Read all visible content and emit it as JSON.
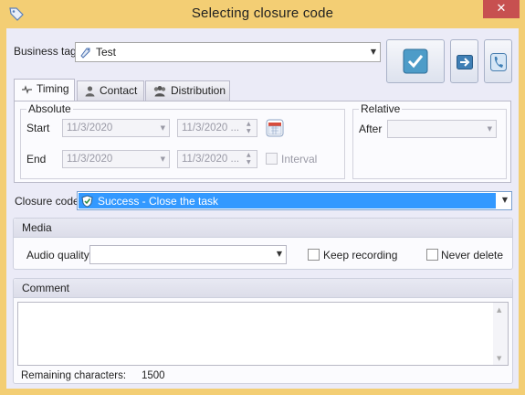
{
  "window": {
    "title": "Selecting closure code",
    "close_glyph": "✕"
  },
  "business_tag": {
    "label": "Business tag",
    "value": "Test",
    "icon": "tag-icon"
  },
  "toolbar": {
    "confirm_icon": "checkmark-icon",
    "forward_icon": "arrow-right-icon",
    "call_icon": "phone-icon"
  },
  "tabs": [
    {
      "label": "Timing",
      "icon": "timing-icon",
      "active": true
    },
    {
      "label": "Contact",
      "icon": "person-icon",
      "active": false
    },
    {
      "label": "Distribution",
      "icon": "group-icon",
      "active": false
    }
  ],
  "timing": {
    "absolute_title": "Absolute",
    "start_label": "Start",
    "start_date": "11/3/2020",
    "start_time": "11/3/2020 ...",
    "end_label": "End",
    "end_date": "11/3/2020",
    "end_time": "11/3/2020 ...",
    "interval_label": "Interval",
    "relative_title": "Relative",
    "after_label": "After",
    "after_value": ""
  },
  "closure": {
    "label": "Closure code",
    "value": "Success - Close the task",
    "color": "#3399ff"
  },
  "media": {
    "title": "Media",
    "audio_label": "Audio quality",
    "audio_value": "",
    "keep_label": "Keep recording",
    "never_label": "Never delete"
  },
  "comment": {
    "title": "Comment",
    "text": "",
    "remaining_label": "Remaining characters:",
    "remaining_count": "1500"
  }
}
